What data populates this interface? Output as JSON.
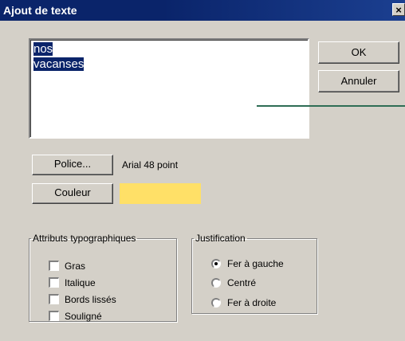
{
  "window": {
    "title": "Ajout de texte",
    "close_glyph": "×"
  },
  "text_content": {
    "lines": [
      "nos",
      "vacanses"
    ]
  },
  "buttons": {
    "ok": "OK",
    "cancel": "Annuler",
    "font": "Police...",
    "color": "Couleur"
  },
  "font_info": "Arial 48 point",
  "color_swatch": "#ffe067",
  "attributes": {
    "legend": "Attributs typographiques",
    "items": [
      {
        "label": "Gras",
        "checked": false
      },
      {
        "label": "Italique",
        "checked": false
      },
      {
        "label": "Bords lissés",
        "checked": false
      },
      {
        "label": "Souligné",
        "checked": false
      }
    ]
  },
  "justification": {
    "legend": "Justification",
    "options": [
      {
        "label": "Fer à gauche",
        "selected": true
      },
      {
        "label": "Centré",
        "selected": false
      },
      {
        "label": "Fer à droite",
        "selected": false
      }
    ]
  }
}
